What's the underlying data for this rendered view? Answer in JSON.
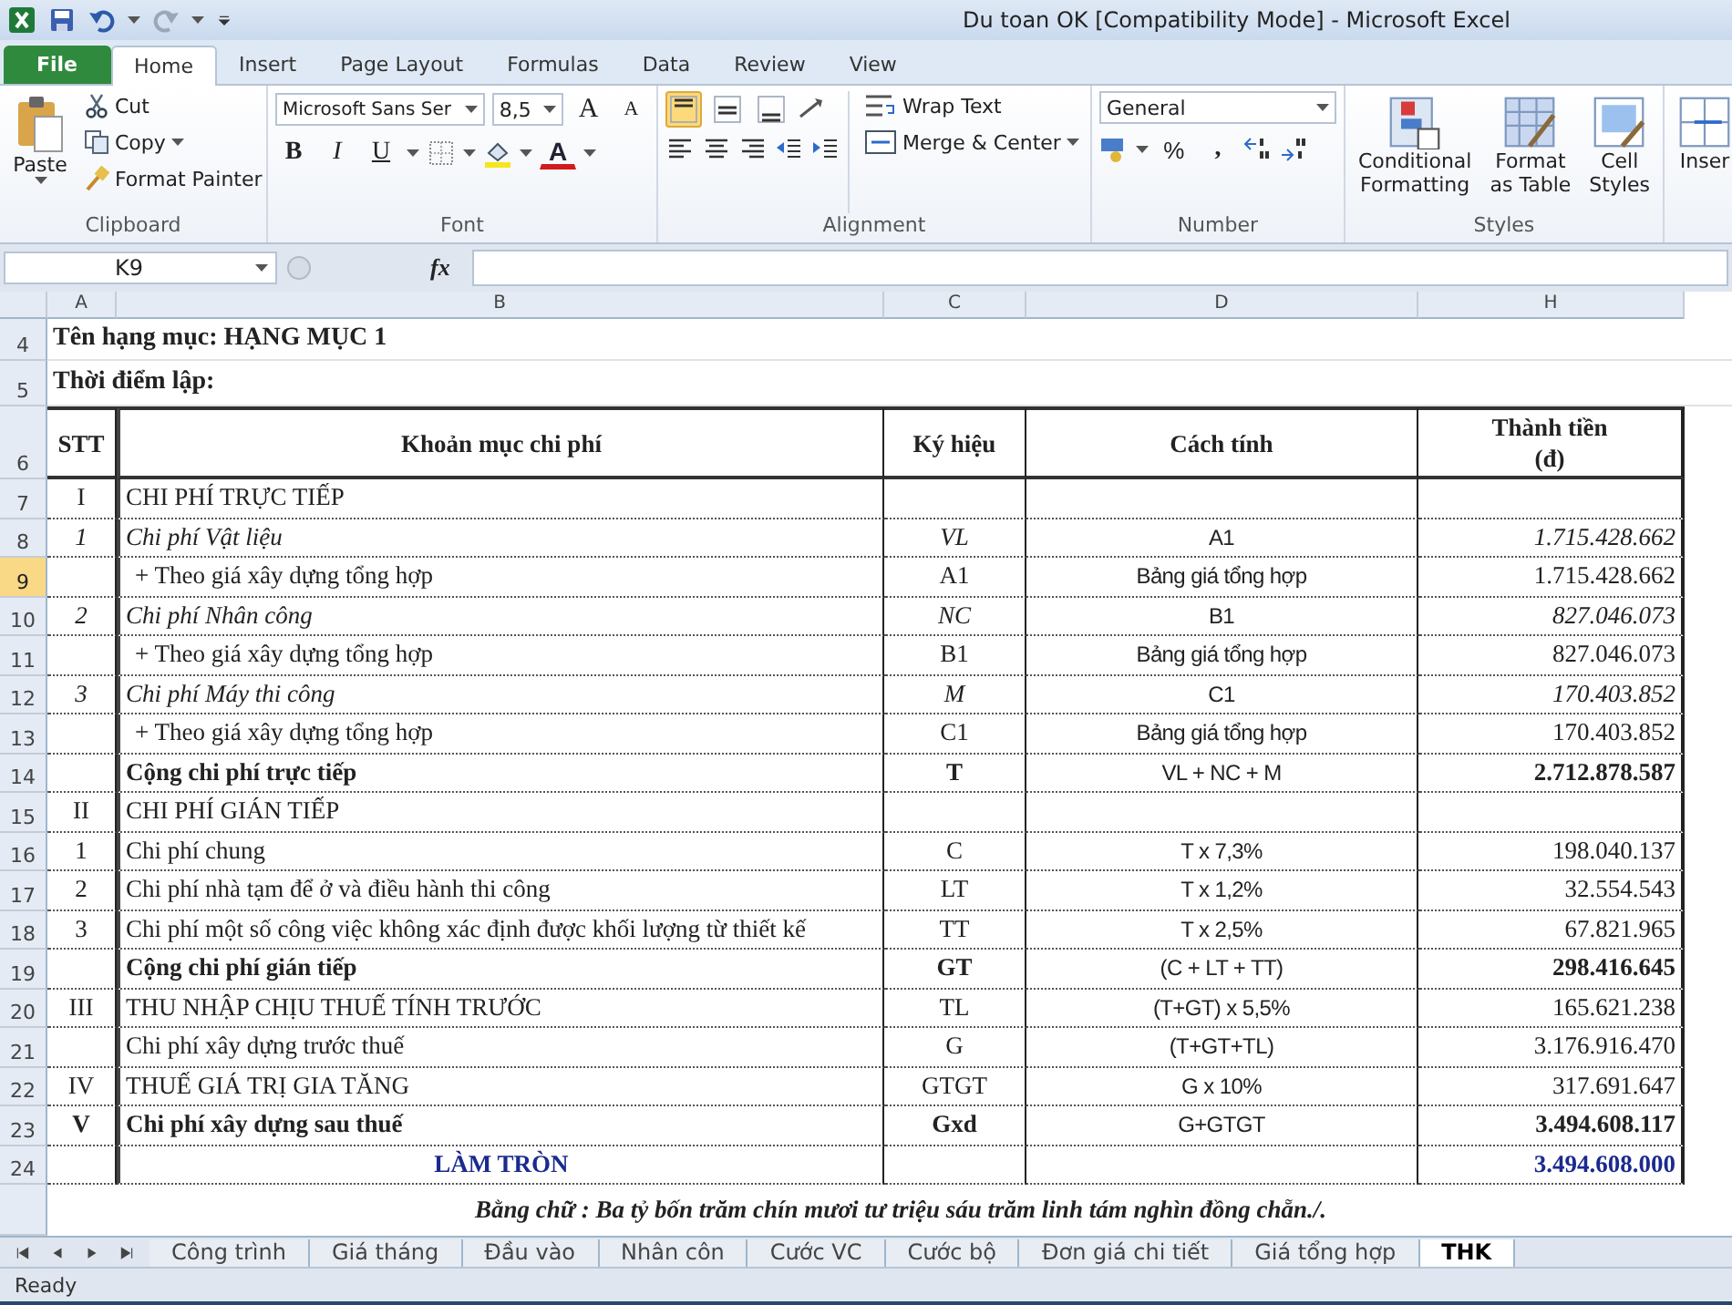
{
  "window": {
    "title": "Du toan OK  [Compatibility Mode]  -  Microsoft Excel"
  },
  "ribbon_tabs": [
    {
      "label": "File",
      "kind": "file",
      "selected": false
    },
    {
      "label": "Home",
      "kind": "tab",
      "selected": true
    },
    {
      "label": "Insert",
      "kind": "tab",
      "selected": false
    },
    {
      "label": "Page Layout",
      "kind": "tab",
      "selected": false
    },
    {
      "label": "Formulas",
      "kind": "tab",
      "selected": false
    },
    {
      "label": "Data",
      "kind": "tab",
      "selected": false
    },
    {
      "label": "Review",
      "kind": "tab",
      "selected": false
    },
    {
      "label": "View",
      "kind": "tab",
      "selected": false
    }
  ],
  "clipboard": {
    "label": "Clipboard",
    "paste": "Paste",
    "cut": "Cut",
    "copy": "Copy",
    "format_painter": "Format Painter"
  },
  "font": {
    "label": "Font",
    "family": "Microsoft Sans Ser",
    "size": "8,5",
    "grow": "A",
    "shrink": "A",
    "bold": "B",
    "italic": "I",
    "underline": "U",
    "color_letter": "A"
  },
  "alignment": {
    "label": "Alignment",
    "wrap_text": "Wrap Text",
    "merge_center": "Merge & Center",
    "vertical": [
      {
        "kind": "top",
        "selected": true
      },
      {
        "kind": "middle",
        "selected": false
      },
      {
        "kind": "bottom",
        "selected": false
      }
    ]
  },
  "number": {
    "label": "Number",
    "format": "General",
    "percent": "%",
    "comma": ","
  },
  "styles": {
    "label": "Styles",
    "buttons": [
      {
        "lines": [
          "Conditional",
          "Formatting"
        ],
        "kind": "conditional"
      },
      {
        "lines": [
          "Format",
          "as Table"
        ],
        "kind": "table"
      },
      {
        "lines": [
          "Cell",
          "Styles"
        ],
        "kind": "cell"
      }
    ]
  },
  "cells": {
    "insert": "Inser"
  },
  "formula_bar": {
    "name_box": "K9",
    "fx": "fx"
  },
  "columns": [
    "A",
    "B",
    "C",
    "D",
    "H"
  ],
  "title_rows": [
    {
      "row": "4",
      "text": "Tên hạng mục: HẠNG MỤC 1",
      "selected": false
    },
    {
      "row": "5",
      "text": "Thời điểm lập:",
      "selected": false
    }
  ],
  "header": {
    "row": "6",
    "selected": false,
    "stt": "STT",
    "item": "Khoản mục chi phí",
    "symbol": "Ký hiệu",
    "formula": "Cách tính",
    "amount": [
      "Thành tiền",
      "(đ)"
    ]
  },
  "rows": [
    {
      "row": "7",
      "kind": "group",
      "selected": false,
      "stt": "I",
      "item": "CHI PHÍ TRỰC TIẾP"
    },
    {
      "row": "8",
      "kind": "item",
      "selected": false,
      "stt": "1",
      "item": "Chi phí Vật liệu",
      "symbol": "VL",
      "formula": "A1",
      "amount": "1.715.428.662"
    },
    {
      "row": "9",
      "kind": "sub",
      "selected": true,
      "item": "+ Theo giá xây dựng tổng hợp",
      "symbol": "A1",
      "formula": "Bảng giá tổng hợp",
      "amount": "1.715.428.662"
    },
    {
      "row": "10",
      "kind": "item",
      "selected": false,
      "stt": "2",
      "item": "Chi phí Nhân công",
      "symbol": "NC",
      "formula": "B1",
      "amount": "827.046.073"
    },
    {
      "row": "11",
      "kind": "sub",
      "selected": false,
      "item": "+ Theo giá xây dựng tổng hợp",
      "symbol": "B1",
      "formula": "Bảng giá tổng hợp",
      "amount": "827.046.073"
    },
    {
      "row": "12",
      "kind": "item",
      "selected": false,
      "stt": "3",
      "item": "Chi phí Máy thi công",
      "symbol": "M",
      "formula": "C1",
      "amount": "170.403.852"
    },
    {
      "row": "13",
      "kind": "sub",
      "selected": false,
      "item": "+ Theo giá xây dựng tổng hợp",
      "symbol": "C1",
      "formula": "Bảng giá tổng hợp",
      "amount": "170.403.852"
    },
    {
      "row": "14",
      "kind": "total",
      "selected": false,
      "item": "Cộng chi phí trực tiếp",
      "symbol": "T",
      "formula": "VL + NC + M",
      "amount": "2.712.878.587"
    },
    {
      "row": "15",
      "kind": "group",
      "selected": false,
      "stt": "II",
      "item": "CHI PHÍ GIÁN TIẾP"
    },
    {
      "row": "16",
      "kind": "detail",
      "selected": false,
      "stt": "1",
      "item": "Chi phí chung",
      "symbol": "C",
      "formula": "T x 7,3%",
      "amount": "198.040.137"
    },
    {
      "row": "17",
      "kind": "detail",
      "selected": false,
      "stt": "2",
      "item": "Chi phí nhà tạm để ở và điều hành thi công",
      "symbol": "LT",
      "formula": "T x 1,2%",
      "amount": "32.554.543"
    },
    {
      "row": "18",
      "kind": "detail",
      "selected": false,
      "stt": "3",
      "item": "Chi phí một số công việc không xác định được khối lượng từ thiết kế",
      "symbol": "TT",
      "formula": "T x 2,5%",
      "amount": "67.821.965"
    },
    {
      "row": "19",
      "kind": "total",
      "selected": false,
      "item": "Cộng chi phí gián tiếp",
      "symbol": "GT",
      "formula": "(C + LT + TT)",
      "amount": "298.416.645"
    },
    {
      "row": "20",
      "kind": "group",
      "selected": false,
      "stt": "III",
      "item": "THU NHẬP CHỊU THUẾ TÍNH TRƯỚC",
      "symbol": "TL",
      "formula": "(T+GT) x 5,5%",
      "amount": "165.621.238"
    },
    {
      "row": "21",
      "kind": "detail",
      "selected": false,
      "item": "Chi phí xây dựng trước thuế",
      "symbol": "G",
      "formula": "(T+GT+TL)",
      "amount": "3.176.916.470"
    },
    {
      "row": "22",
      "kind": "group",
      "selected": false,
      "stt": "IV",
      "item": "THUẾ GIÁ TRỊ GIA TĂNG",
      "symbol": "GTGT",
      "formula": "G x 10%",
      "amount": "317.691.647"
    },
    {
      "row": "23",
      "kind": "total",
      "selected": false,
      "stt": "V",
      "item": "Chi phí xây dựng sau thuế",
      "symbol": "Gxd",
      "formula": "G+GTGT",
      "amount": "3.494.608.117"
    },
    {
      "row": "24",
      "kind": "round",
      "selected": false,
      "item": "LÀM TRÒN",
      "amount": "3.494.608.000"
    }
  ],
  "in_words": "Bằng chữ : Ba tỷ bốn trăm chín mươi tư triệu sáu trăm linh tám nghìn đồng chẵn./.",
  "sheet_tabs": [
    {
      "label": "Công trình",
      "selected": false
    },
    {
      "label": "Giá tháng",
      "selected": false
    },
    {
      "label": "Đầu vào",
      "selected": false
    },
    {
      "label": "Nhân côn",
      "selected": false
    },
    {
      "label": "Cước VC",
      "selected": false
    },
    {
      "label": "Cước bộ",
      "selected": false
    },
    {
      "label": "Đơn giá chi tiết",
      "selected": false
    },
    {
      "label": "Giá tổng hợp",
      "selected": false
    },
    {
      "label": "THK",
      "selected": true
    }
  ],
  "status_bar": {
    "text": "Ready"
  }
}
